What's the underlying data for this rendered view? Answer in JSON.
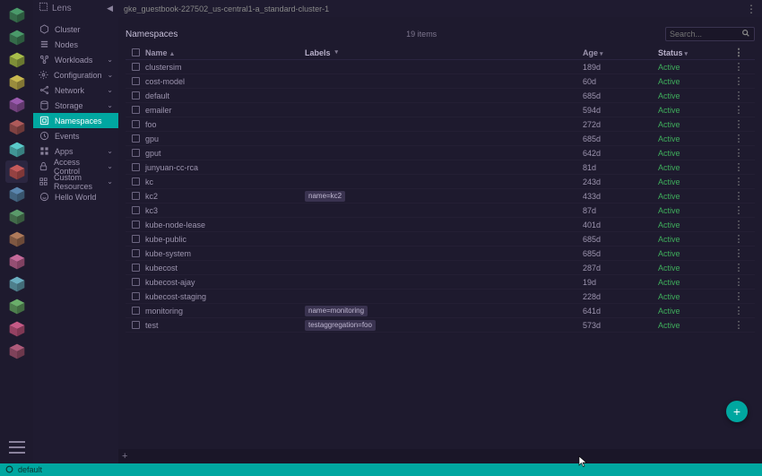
{
  "brand": "Lens",
  "breadcrumb": "gke_guestbook-227502_us-central1-a_standard-cluster-1",
  "sidebar": {
    "items": [
      {
        "icon": "hex",
        "label": "Cluster",
        "chev": false
      },
      {
        "icon": "nodes",
        "label": "Nodes",
        "chev": false
      },
      {
        "icon": "work",
        "label": "Workloads",
        "chev": true
      },
      {
        "icon": "conf",
        "label": "Configuration",
        "chev": true
      },
      {
        "icon": "net",
        "label": "Network",
        "chev": true
      },
      {
        "icon": "stor",
        "label": "Storage",
        "chev": true
      },
      {
        "icon": "ns",
        "label": "Namespaces",
        "chev": false,
        "active": true
      },
      {
        "icon": "ev",
        "label": "Events",
        "chev": false
      },
      {
        "icon": "apps",
        "label": "Apps",
        "chev": true
      },
      {
        "icon": "acc",
        "label": "Access Control",
        "chev": true
      },
      {
        "icon": "crd",
        "label": "Custom Resources",
        "chev": true
      },
      {
        "icon": "hello",
        "label": "Hello World",
        "chev": false
      }
    ]
  },
  "page": {
    "title": "Namespaces",
    "count": "19 items",
    "search_placeholder": "Search..."
  },
  "columns": {
    "name": "Name",
    "labels": "Labels",
    "age": "Age",
    "status": "Status"
  },
  "rows": [
    {
      "name": "clustersim",
      "labels": [],
      "age": "189d",
      "status": "Active"
    },
    {
      "name": "cost-model",
      "labels": [],
      "age": "60d",
      "status": "Active"
    },
    {
      "name": "default",
      "labels": [],
      "age": "685d",
      "status": "Active"
    },
    {
      "name": "emailer",
      "labels": [],
      "age": "594d",
      "status": "Active"
    },
    {
      "name": "foo",
      "labels": [],
      "age": "272d",
      "status": "Active"
    },
    {
      "name": "gpu",
      "labels": [],
      "age": "685d",
      "status": "Active"
    },
    {
      "name": "gput",
      "labels": [],
      "age": "642d",
      "status": "Active"
    },
    {
      "name": "junyuan-cc-rca",
      "labels": [],
      "age": "81d",
      "status": "Active"
    },
    {
      "name": "kc",
      "labels": [],
      "age": "243d",
      "status": "Active"
    },
    {
      "name": "kc2",
      "labels": [
        "name=kc2"
      ],
      "age": "433d",
      "status": "Active"
    },
    {
      "name": "kc3",
      "labels": [],
      "age": "87d",
      "status": "Active"
    },
    {
      "name": "kube-node-lease",
      "labels": [],
      "age": "401d",
      "status": "Active"
    },
    {
      "name": "kube-public",
      "labels": [],
      "age": "685d",
      "status": "Active"
    },
    {
      "name": "kube-system",
      "labels": [],
      "age": "685d",
      "status": "Active"
    },
    {
      "name": "kubecost",
      "labels": [],
      "age": "287d",
      "status": "Active"
    },
    {
      "name": "kubecost-ajay",
      "labels": [],
      "age": "19d",
      "status": "Active"
    },
    {
      "name": "kubecost-staging",
      "labels": [],
      "age": "228d",
      "status": "Active"
    },
    {
      "name": "monitoring",
      "labels": [
        "name=monitoring"
      ],
      "age": "641d",
      "status": "Active"
    },
    {
      "name": "test",
      "labels": [
        "testaggregation=foo"
      ],
      "age": "573d",
      "status": "Active"
    }
  ],
  "statusbar": {
    "context": "default"
  },
  "add_label": "+",
  "tab_add": "+",
  "colors": {
    "accent": "#00a7a0",
    "status_active": "#3fae5c"
  }
}
